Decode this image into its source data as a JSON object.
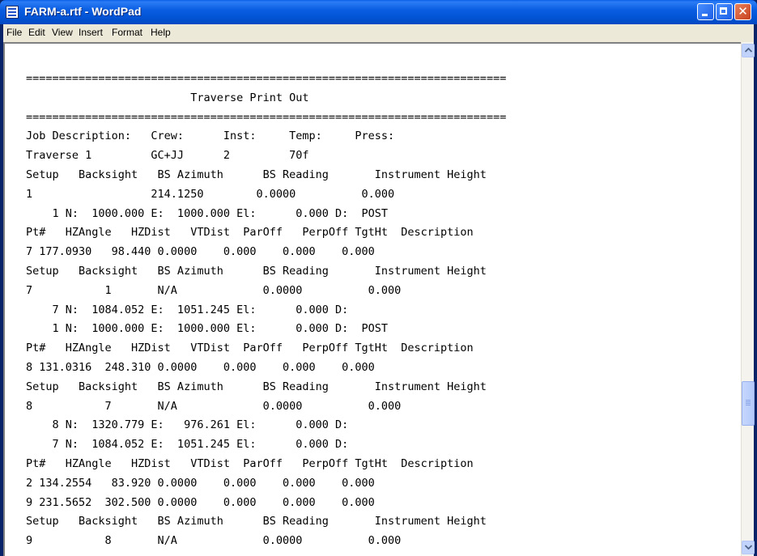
{
  "window": {
    "title": "FARM-a.rtf - WordPad",
    "controls": {
      "minimize_icon": "minimize-icon",
      "maximize_icon": "maximize-icon",
      "close_glyph": "✕"
    }
  },
  "menu": [
    "File",
    "Edit",
    "View",
    "Insert",
    "Format",
    "Help"
  ],
  "document": {
    "lines": [
      "=========================================================================",
      "                         Traverse Print Out",
      "=========================================================================",
      "Job Description:   Crew:      Inst:     Temp:     Press:",
      "Traverse 1         GC+JJ      2         70f",
      "Setup   Backsight   BS Azimuth      BS Reading       Instrument Height",
      "1                  214.1250        0.0000          0.000",
      "    1 N:  1000.000 E:  1000.000 El:      0.000 D:  POST",
      "Pt#   HZAngle   HZDist   VTDist  ParOff   PerpOff TgtHt  Description",
      "7 177.0930   98.440 0.0000    0.000    0.000    0.000",
      "Setup   Backsight   BS Azimuth      BS Reading       Instrument Height",
      "7           1       N/A             0.0000          0.000",
      "    7 N:  1084.052 E:  1051.245 El:      0.000 D:",
      "    1 N:  1000.000 E:  1000.000 El:      0.000 D:  POST",
      "Pt#   HZAngle   HZDist   VTDist  ParOff   PerpOff TgtHt  Description",
      "8 131.0316  248.310 0.0000    0.000    0.000    0.000",
      "Setup   Backsight   BS Azimuth      BS Reading       Instrument Height",
      "8           7       N/A             0.0000          0.000",
      "    8 N:  1320.779 E:   976.261 El:      0.000 D:",
      "    7 N:  1084.052 E:  1051.245 El:      0.000 D:",
      "Pt#   HZAngle   HZDist   VTDist  ParOff   PerpOff TgtHt  Description",
      "2 134.2554   83.920 0.0000    0.000    0.000    0.000",
      "9 231.5652  302.500 0.0000    0.000    0.000    0.000",
      "Setup   Backsight   BS Azimuth      BS Reading       Instrument Height",
      "9           8       N/A             0.0000          0.000"
    ]
  },
  "scrollbar": {
    "up_icon": "scroll-up-arrow-icon",
    "down_icon": "scroll-down-arrow-icon",
    "thumb_position_fraction": 0.74
  },
  "colors": {
    "titlebar": "#0355d6",
    "menubar": "#ece9d8",
    "document_bg": "#ffffff",
    "close_button": "#c8401e"
  }
}
